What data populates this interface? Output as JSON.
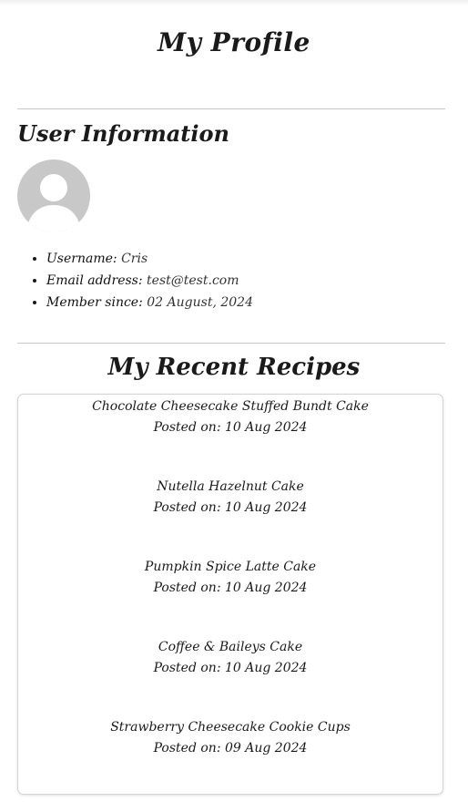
{
  "page": {
    "title": "My Profile"
  },
  "user_info": {
    "heading": "User Information",
    "avatar_icon": "user-avatar-icon",
    "fields": [
      {
        "label": "Username:",
        "value": "Cris"
      },
      {
        "label": "Email address:",
        "value": "test@test.com"
      },
      {
        "label": "Member since:",
        "value": "02 August, 2024"
      }
    ]
  },
  "recipes": {
    "heading": "My Recent Recipes",
    "posted_prefix": "Posted on:",
    "items": [
      {
        "name": "Chocolate Cheesecake Stuffed Bundt Cake",
        "date": "10 Aug 2024"
      },
      {
        "name": "Nutella Hazelnut Cake",
        "date": "10 Aug 2024"
      },
      {
        "name": "Pumpkin Spice Latte Cake",
        "date": "10 Aug 2024"
      },
      {
        "name": "Coffee & Baileys Cake",
        "date": "10 Aug 2024"
      },
      {
        "name": "Strawberry Cheesecake Cookie Cups",
        "date": "09 Aug 2024"
      }
    ]
  },
  "colors": {
    "text": "#1a1a1a",
    "divider": "#c9c9c9",
    "avatar_bg": "#c8c8c8",
    "card_border": "#d4d4d4"
  }
}
